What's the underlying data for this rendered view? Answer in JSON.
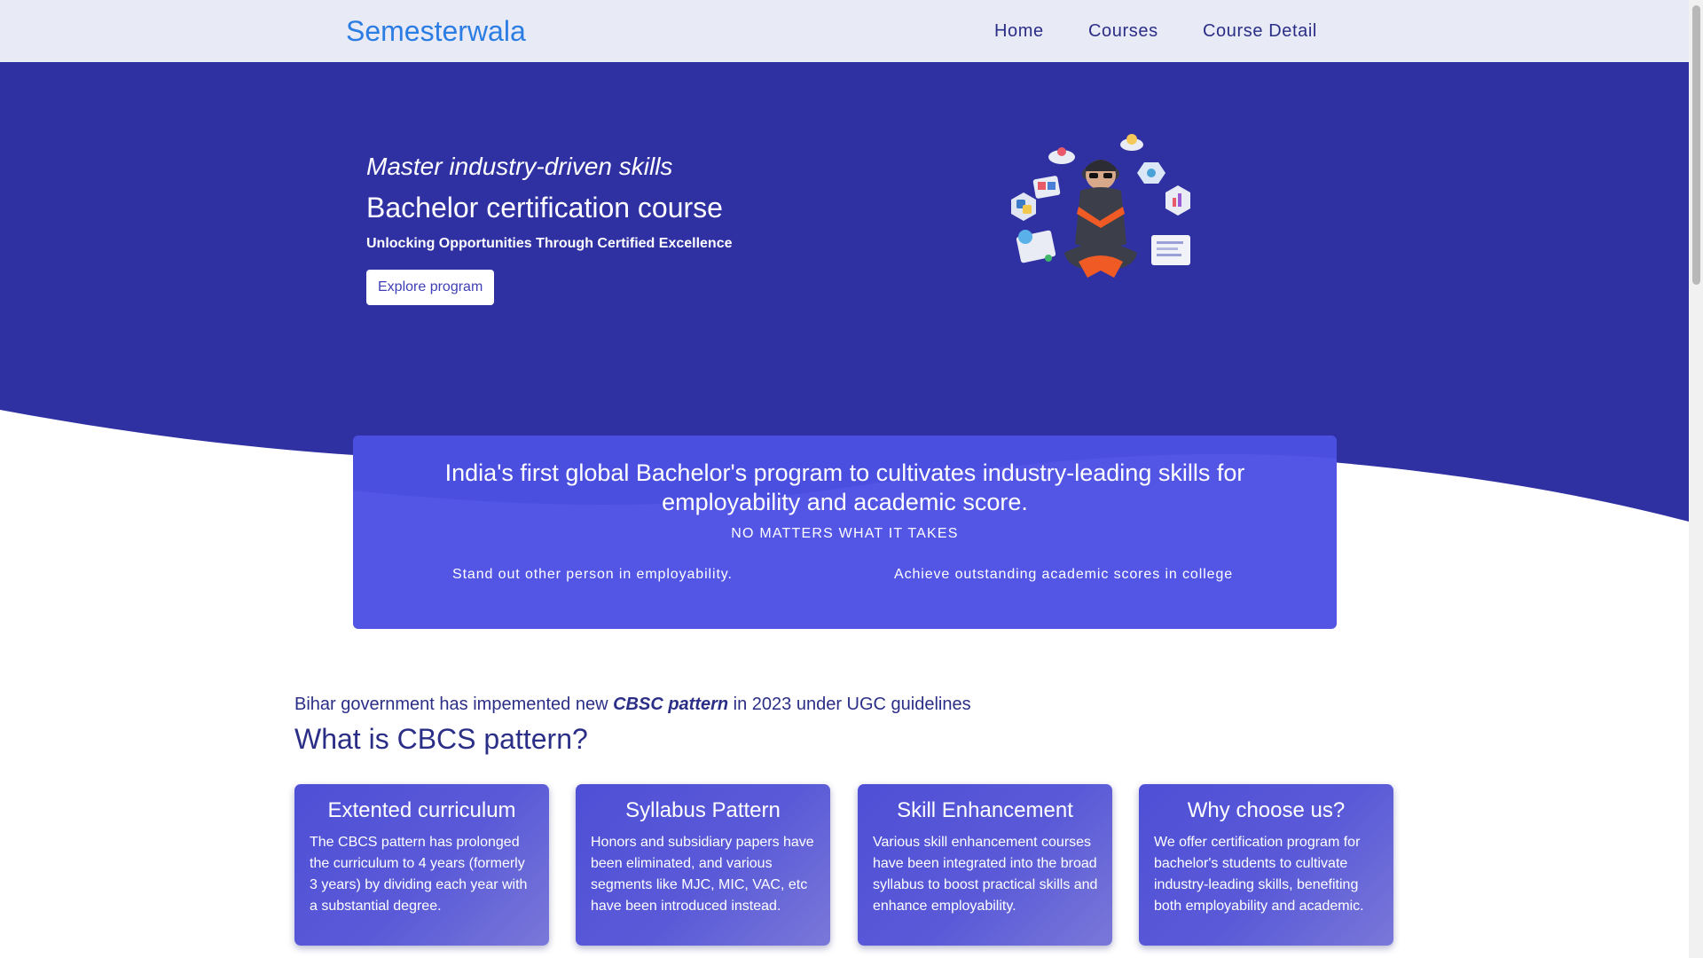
{
  "navbar": {
    "brand": "Semesterwala",
    "links": [
      "Home",
      "Courses",
      "Course Detail"
    ]
  },
  "hero": {
    "tagline": "Master industry-driven skills",
    "title": "Bachelor certification course",
    "subtitle": "Unlocking Opportunities Through Certified Excellence",
    "cta_label": "Explore program",
    "illustration_icon": "student-avatar-with-floating-skill-icons"
  },
  "banner": {
    "heading": "India's first global Bachelor's program to cultivates industry-leading skills for employability and academic score.",
    "caption": "NO MATTERS WHAT IT TAKES",
    "points": [
      "Stand out other person in employability.",
      "Achieve outstanding academic scores in college"
    ]
  },
  "cbcs": {
    "intro_before": "Bihar government has impemented new ",
    "intro_emphasis": "CBSC pattern",
    "intro_after": " in 2023 under UGC guidelines",
    "title": "What is CBCS pattern?",
    "cards": [
      {
        "title": "Extented curriculum",
        "body": "The CBCS pattern has prolonged the curriculum to 4 years (formerly 3 years) by dividing each year with a substantial degree."
      },
      {
        "title": "Syllabus Pattern",
        "body": "Honors and subsidiary papers have been eliminated, and various segments like MJC, MIC, VAC, etc have been introduced instead."
      },
      {
        "title": "Skill Enhancement",
        "body": "Various skill enhancement courses have been integrated into the broad syllabus to boost practical skills and enhance employability."
      },
      {
        "title": "Why choose us?",
        "body": "We offer certification program for bachelor's students to cultivate industry-leading skills, benefiting both employability and academic."
      }
    ]
  },
  "colors": {
    "hero_bg": "#2f31a3",
    "banner_bg": "#5356e4",
    "brand": "#2b7de3",
    "nav_text": "#2b2e86"
  }
}
